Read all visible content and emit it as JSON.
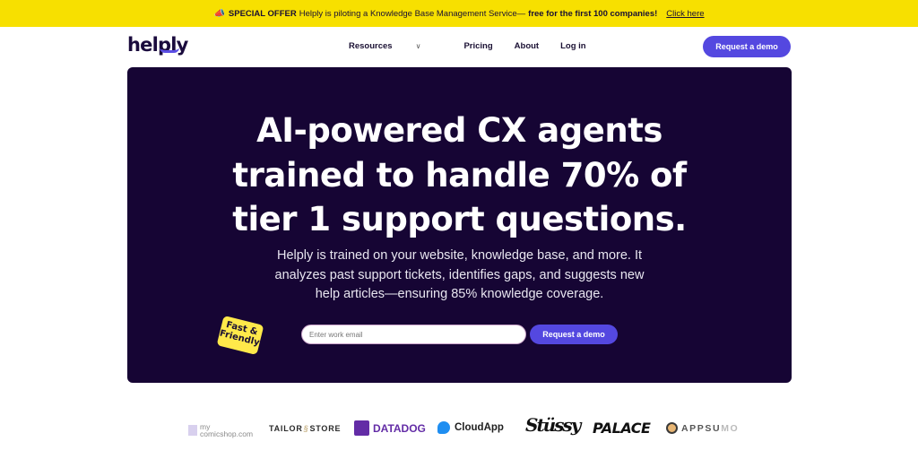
{
  "banner": {
    "icon": "megaphone-icon",
    "label": "SPECIAL OFFER",
    "message": "Helply is piloting a Knowledge Base Management Service—",
    "highlight": "free for the first 100 companies!",
    "link": "Click here"
  },
  "nav": {
    "logo": "helply",
    "items": [
      {
        "label": "Resources",
        "has_dropdown": true
      },
      {
        "label": "Pricing"
      },
      {
        "label": "About"
      },
      {
        "label": "Log in"
      }
    ],
    "dropdown_glyph": "∨",
    "cta": "Request a demo"
  },
  "hero": {
    "headline_lines": [
      "AI-powered CX agents",
      "trained to handle 70% of",
      "tier 1 support questions."
    ],
    "subtitle_lines": [
      "Helply is trained on your website, knowledge base, and more. It",
      "analyzes past support tickets, identifies gaps, and suggests new",
      "help articles—ensuring 85% knowledge coverage."
    ],
    "sticker_lines": [
      "Fast &",
      "Friendly"
    ],
    "email_placeholder": "Enter work email",
    "email_value": "",
    "cta": "Request a demo"
  },
  "logos": [
    {
      "name": "mycomicshop",
      "line1": "my",
      "line2": "comicshop.com"
    },
    {
      "name": "tailorstore",
      "left": "TAILOR",
      "mid": "§",
      "right": "STORE"
    },
    {
      "name": "datadog",
      "text": "DATADOG"
    },
    {
      "name": "cloudapp",
      "text": "CloudApp"
    },
    {
      "name": "stussy",
      "text": "Stüssy"
    },
    {
      "name": "palace",
      "text": "PALACE"
    },
    {
      "name": "appsumo",
      "text": "APPSU",
      "faded": "MO"
    }
  ],
  "colors": {
    "banner": "#f7e000",
    "hero_bg": "#160534",
    "accent": "#5448e0",
    "sticker": "#ffe94a"
  }
}
